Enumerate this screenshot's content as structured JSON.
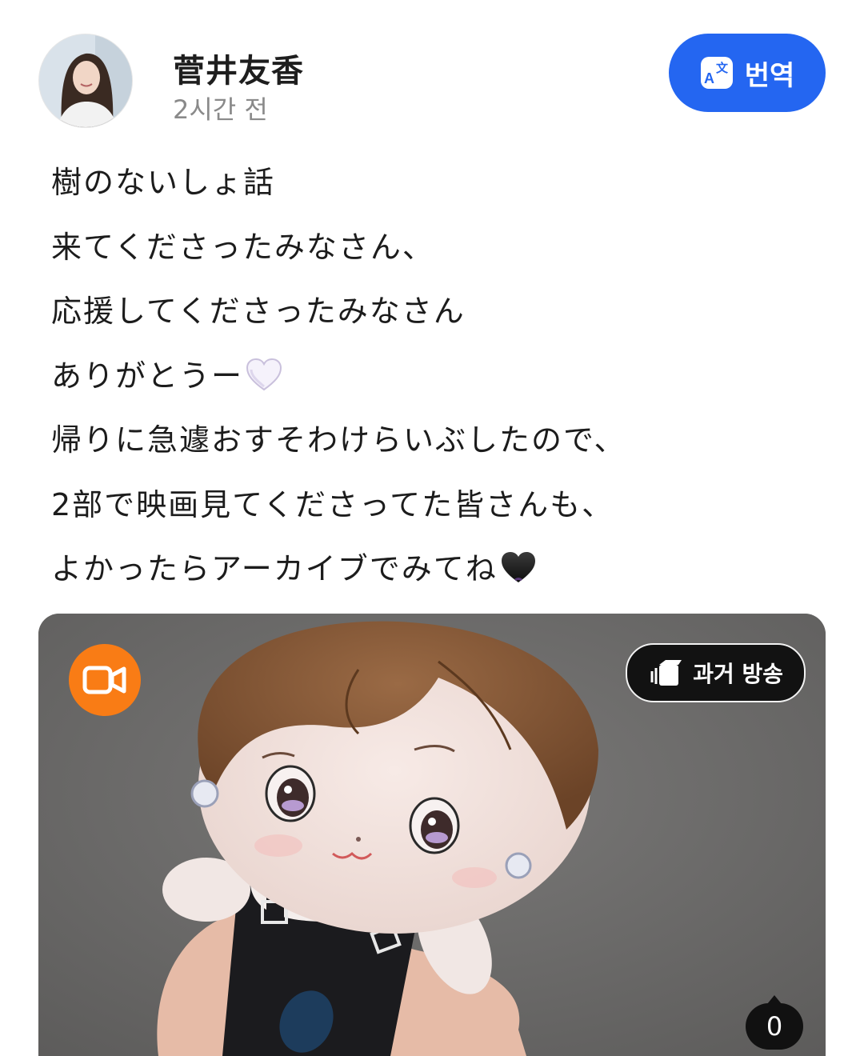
{
  "author": {
    "name": "菅井友香",
    "time": "2시간 전"
  },
  "translate_button": {
    "label": "번역",
    "icon": "translate-icon"
  },
  "post": {
    "lines": [
      "樹のないしょ話",
      "来てくださったみなさん、",
      "応援してくださったみなさん",
      "ありがとうー",
      "帰りに急遽おすそわけらいぶしたので、",
      "2部で映画見てくださってた皆さんも、",
      "よかったらアーカイブでみてね"
    ],
    "emojis": {
      "line4": "white-heart",
      "line7": "black-heart"
    }
  },
  "media": {
    "type_icon": "video-camera-icon",
    "badge_label": "과거 방송",
    "badge_icon": "archive-icon",
    "comment_count": "0",
    "colors": {
      "video_badge": "#f97c15",
      "accent": "#2466f1"
    }
  }
}
